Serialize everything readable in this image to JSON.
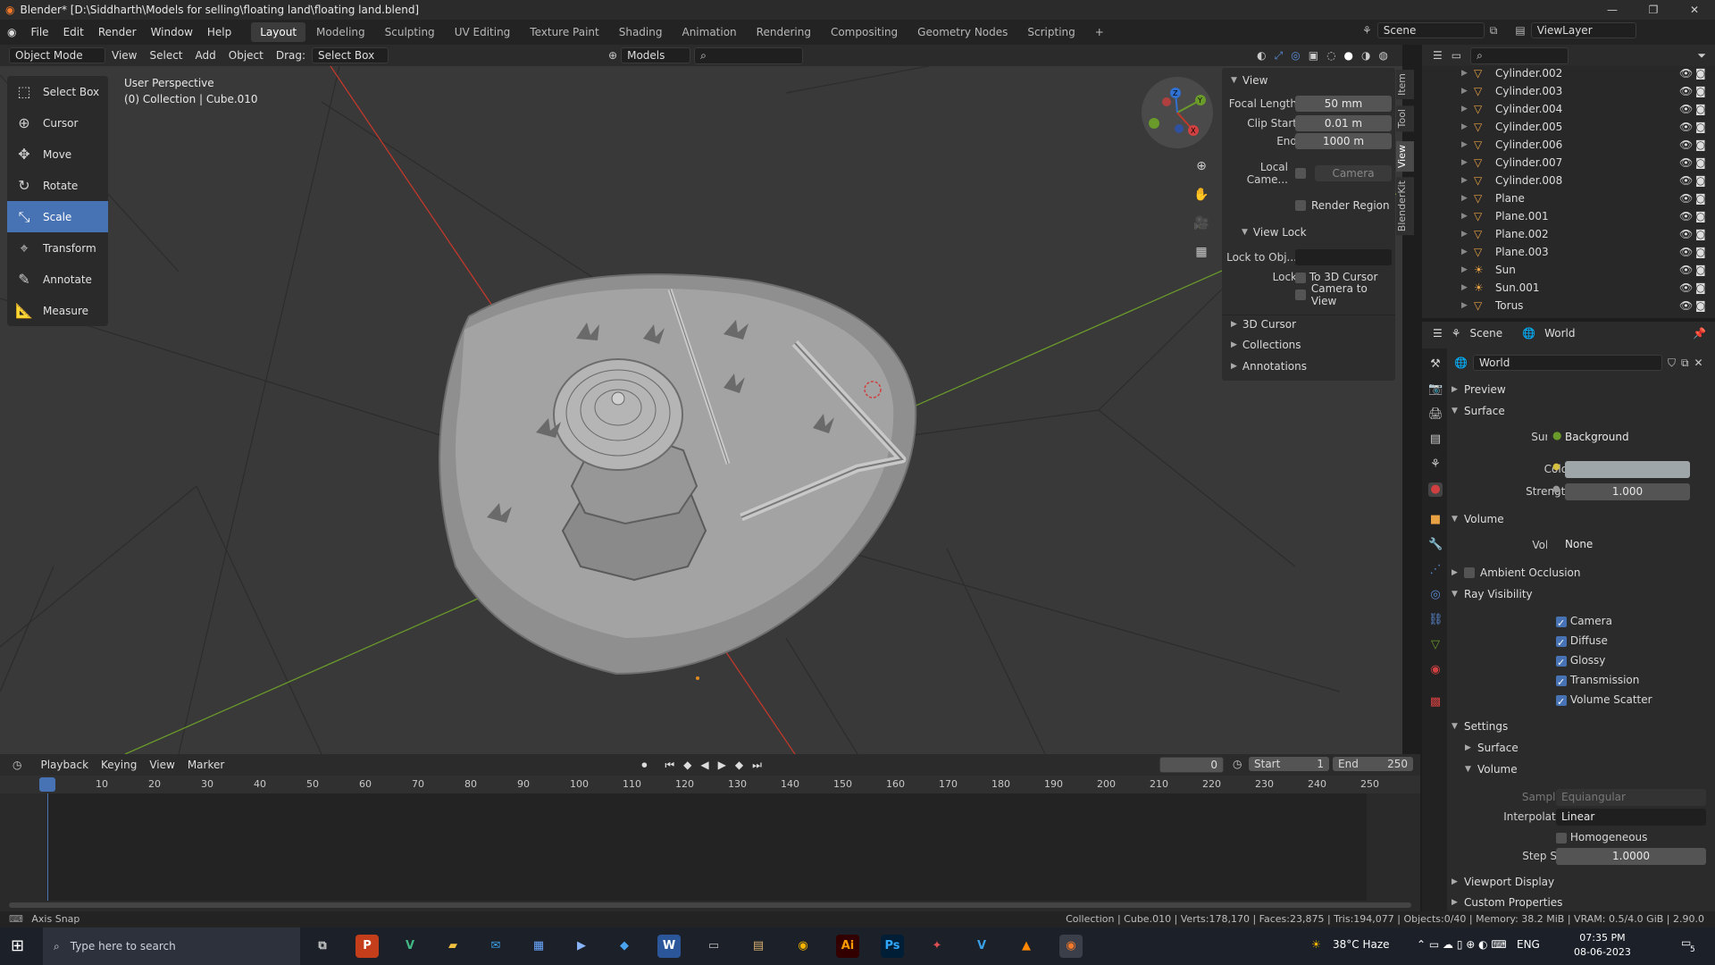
{
  "titlebar": {
    "title": "Blender* [D:\\Siddharth\\Models for selling\\floating land\\floating land.blend]"
  },
  "menu": {
    "items": [
      "File",
      "Edit",
      "Render",
      "Window",
      "Help"
    ]
  },
  "workspaces": [
    "Layout",
    "Modeling",
    "Sculpting",
    "UV Editing",
    "Texture Paint",
    "Shading",
    "Animation",
    "Rendering",
    "Compositing",
    "Geometry Nodes",
    "Scripting"
  ],
  "active_workspace": "Layout",
  "scene": {
    "label": "Scene",
    "viewlayer": "ViewLayer"
  },
  "header3d": {
    "mode": "Object Mode",
    "view": "View",
    "select": "Select",
    "add": "Add",
    "object": "Object",
    "drag_label": "Drag:",
    "drag_value": "Select Box",
    "collection": "Models"
  },
  "tools": [
    "Select Box",
    "Cursor",
    "Move",
    "Rotate",
    "Scale",
    "Transform",
    "Annotate",
    "Measure"
  ],
  "active_tool": "Scale",
  "viewport_info": {
    "line1": "User Perspective",
    "line2": "(0) Collection | Cube.010"
  },
  "npanel": {
    "view_header": "View",
    "focal_length_label": "Focal Length",
    "focal_length": "50 mm",
    "clip_start_label": "Clip Start",
    "clip_start": "0.01 m",
    "end_label": "End",
    "end": "1000 m",
    "local_camera_label": "Local Came...",
    "camera_placeholder": "Camera",
    "render_region": "Render Region",
    "view_lock": "View Lock",
    "lock_to_obj": "Lock to Obj...",
    "lock_label": "Lock",
    "to_3d_cursor": "To 3D Cursor",
    "camera_to_view": "Camera to View",
    "cursor_3d": "3D Cursor",
    "collections": "Collections",
    "annotations": "Annotations",
    "tabs": [
      "Item",
      "Tool",
      "View",
      "BlenderKit"
    ]
  },
  "outliner": {
    "items": [
      "Cylinder.002",
      "Cylinder.003",
      "Cylinder.004",
      "Cylinder.005",
      "Cylinder.006",
      "Cylinder.007",
      "Cylinder.008",
      "Plane",
      "Plane.001",
      "Plane.002",
      "Plane.003",
      "Sun",
      "Sun.001",
      "Torus"
    ]
  },
  "properties": {
    "scene_tab": "Scene",
    "world_tab": "World",
    "world_name": "World",
    "preview": "Preview",
    "surface": "Surface",
    "surface_label": "Surface",
    "surface_value": "Background",
    "color_label": "Color",
    "strength_label": "Strength",
    "strength": "1.000",
    "volume_header": "Volume",
    "volume_label": "Volume",
    "volume_value": "None",
    "ambient_occlusion": "Ambient Occlusion",
    "ray_visibility": "Ray Visibility",
    "ray_items": [
      "Camera",
      "Diffuse",
      "Glossy",
      "Transmission",
      "Volume Scatter"
    ],
    "settings": "Settings",
    "settings_surface": "Surface",
    "settings_volume": "Volume",
    "sampling_label": "Sampling",
    "sampling_value": "Equiangular",
    "interpolation_label": "Interpolation",
    "interpolation_value": "Linear",
    "homogeneous": "Homogeneous",
    "step_size_label": "Step Size",
    "step_size": "1.0000",
    "viewport_display": "Viewport Display",
    "custom_properties": "Custom Properties"
  },
  "timeline": {
    "playback": "Playback",
    "keying": "Keying",
    "view": "View",
    "marker": "Marker",
    "current_frame": "0",
    "start_label": "Start",
    "start": "1",
    "end_label": "End",
    "end": "250",
    "ticks": [
      "0",
      "10",
      "20",
      "30",
      "40",
      "50",
      "60",
      "70",
      "80",
      "90",
      "100",
      "110",
      "120",
      "130",
      "140",
      "150",
      "160",
      "170",
      "180",
      "190",
      "200",
      "210",
      "220",
      "230",
      "240",
      "250"
    ]
  },
  "status": {
    "left": "Axis Snap",
    "right": "Collection | Cube.010 | Verts:178,170 | Faces:23,875 | Tris:194,077 | Objects:0/40 | Memory: 38.2 MiB | VRAM: 0.5/4.0 GiB | 2.90.0"
  },
  "taskbar": {
    "search_placeholder": "Type here to search",
    "weather": "38°C  Haze",
    "lang": "ENG",
    "time": "07:35 PM",
    "date": "08-06-2023",
    "notif": "5"
  },
  "colors": {
    "accent": "#4772b3",
    "viewport_bg": "#393939",
    "x_axis": "#c0392b",
    "y_axis": "#6a9a2a",
    "object_orange": "#e8a243"
  }
}
